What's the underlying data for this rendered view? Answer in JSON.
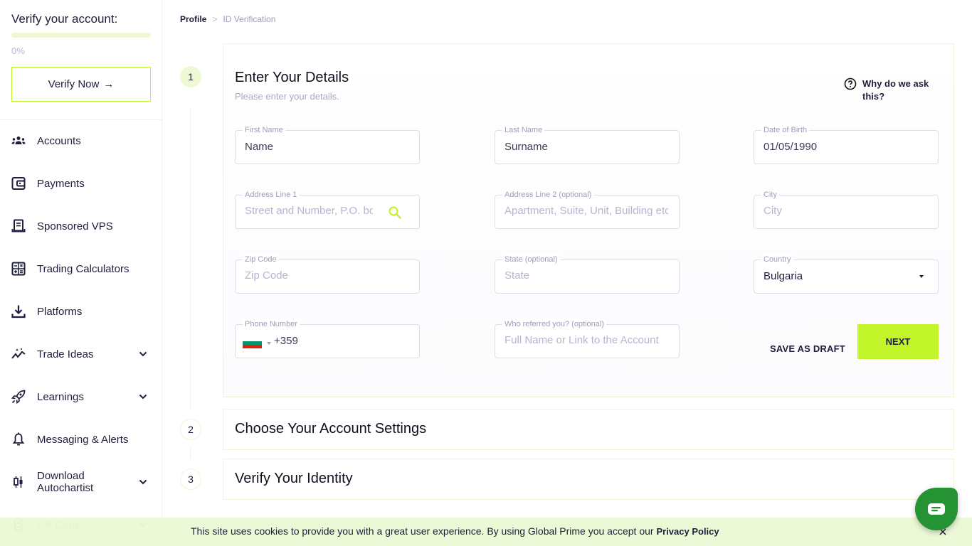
{
  "sidebar": {
    "verify_title": "Verify your account:",
    "progress_value": 0,
    "progress_label": "0%",
    "verify_button": "Verify Now",
    "verify_arrow": "→",
    "items": [
      {
        "label": "Accounts",
        "icon": "users-icon",
        "has_chevron": false
      },
      {
        "label": "Payments",
        "icon": "wallet-icon",
        "has_chevron": false
      },
      {
        "label": "Sponsored VPS",
        "icon": "server-icon",
        "has_chevron": false
      },
      {
        "label": "Trading Calculators",
        "icon": "calculator-icon",
        "has_chevron": false
      },
      {
        "label": "Platforms",
        "icon": "download-icon",
        "has_chevron": false
      },
      {
        "label": "Trade Ideas",
        "icon": "sparkle-chart-icon",
        "has_chevron": true
      },
      {
        "label": "Learnings",
        "icon": "rocket-icon",
        "has_chevron": true
      },
      {
        "label": "Messaging & Alerts",
        "icon": "bell-icon",
        "has_chevron": false
      },
      {
        "label": "Download Autochartist",
        "icon": "candlestick-icon",
        "has_chevron": true
      },
      {
        "label": "GP Copy",
        "icon": "award-icon",
        "has_chevron": true
      }
    ]
  },
  "breadcrumb": {
    "root": "Profile",
    "separator": ">",
    "current": "ID Verification"
  },
  "steps": [
    {
      "number": "1",
      "title": "Enter Your Details",
      "subtitle": "Please enter your details.",
      "active": true
    },
    {
      "number": "2",
      "title": "Choose Your Account Settings",
      "active": false
    },
    {
      "number": "3",
      "title": "Verify Your Identity",
      "active": false
    }
  ],
  "why_link": "Why do we ask this?",
  "form": {
    "first_name": {
      "label": "First Name",
      "value": "Name"
    },
    "last_name": {
      "label": "Last Name",
      "value": "Surname"
    },
    "dob": {
      "label": "Date of Birth",
      "value": "01/05/1990"
    },
    "address1": {
      "label": "Address Line 1",
      "placeholder": "Street and Number, P.O. box"
    },
    "address2": {
      "label": "Address Line 2 (optional)",
      "placeholder": "Apartment, Suite, Unit, Building etc."
    },
    "city": {
      "label": "City",
      "placeholder": "City"
    },
    "zip": {
      "label": "Zip Code",
      "placeholder": "Zip Code"
    },
    "state": {
      "label": "State (optional)",
      "placeholder": "State"
    },
    "country": {
      "label": "Country",
      "value": "Bulgaria"
    },
    "phone": {
      "label": "Phone Number",
      "code": "+359",
      "flag_colors": [
        "#ffffff",
        "#00966e",
        "#d62612"
      ]
    },
    "referral": {
      "label": "Who referred you? (optional)",
      "placeholder": "Full Name or Link to the Account"
    }
  },
  "actions": {
    "save_draft": "SAVE AS DRAFT",
    "next": "NEXT"
  },
  "cookie": {
    "text": "This site uses cookies to provide you with a great user experience. By using Global Prime you accept our ",
    "link": "Privacy Policy"
  },
  "colors": {
    "accent": "#c2f42a",
    "chat": "#259233",
    "text_dark": "#1e1e3c"
  }
}
